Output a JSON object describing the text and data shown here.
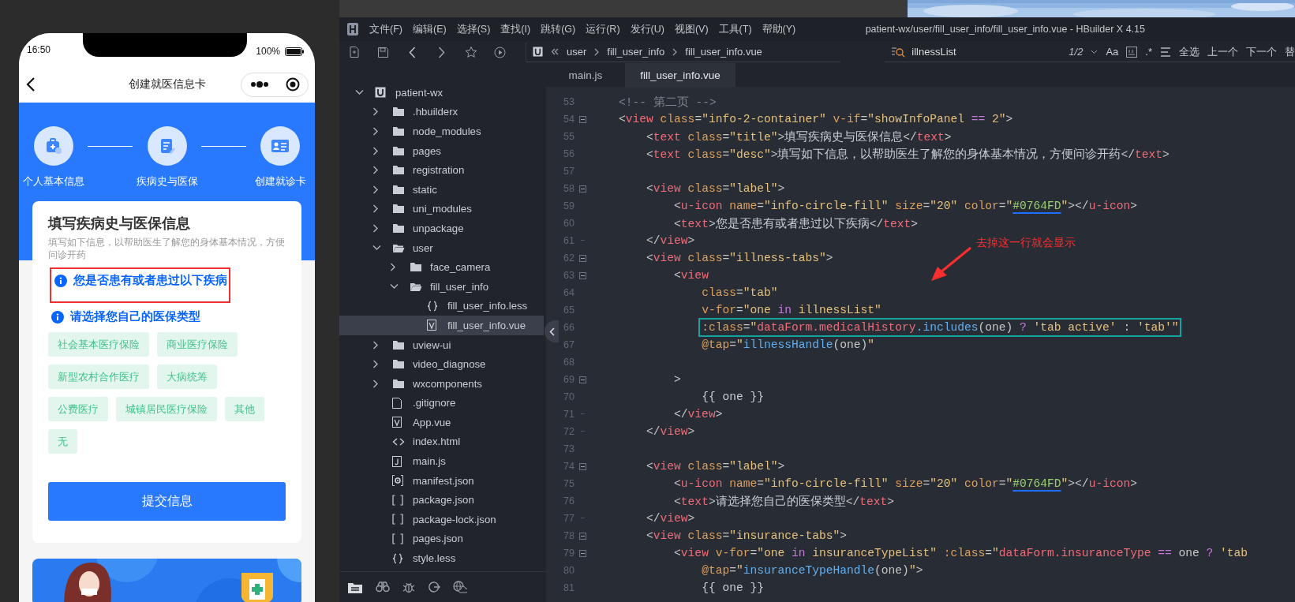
{
  "phone": {
    "time": "16:50",
    "battery": "100%",
    "title": "创建就医信息卡",
    "steps": [
      {
        "label": "个人基本信息",
        "kind": "kit"
      },
      {
        "label": "疾病史与医保",
        "kind": "doc"
      },
      {
        "label": "创建就诊卡",
        "kind": "card"
      }
    ],
    "form": {
      "title": "填写疾病史与医保信息",
      "desc": "填写如下信息，以帮助医生了解您的身体基本情况，方便问诊开药",
      "illness_label": "您是否患有或者患过以下疾病",
      "illness_highlighted": true,
      "insurance_label": "请选择您自己的医保类型",
      "insurance_types": [
        "社会基本医疗保险",
        "商业医疗保险",
        "新型农村合作医疗",
        "大病统筹",
        "公费医疗",
        "城镇居民医疗保险",
        "其他",
        "无"
      ],
      "submit": "提交信息"
    }
  },
  "ide": {
    "menu": [
      "文件(F)",
      "编辑(E)",
      "选择(S)",
      "查找(I)",
      "跳转(G)",
      "运行(R)",
      "发行(U)",
      "视图(V)",
      "工具(T)",
      "帮助(Y)"
    ],
    "window_title": "patient-wx/user/fill_user_info/fill_user_info.vue - HBuilder X 4.15",
    "breadcrumb": [
      "user",
      "fill_user_info",
      "fill_user_info.vue"
    ],
    "search": {
      "value": "illnessList",
      "count": "1/2",
      "case": "Aa",
      "regex": ".*",
      "select_all": "全选",
      "prev": "上一个",
      "next": "下一个",
      "replace": "替"
    },
    "tabs": [
      {
        "label": "main.js",
        "selected": false
      },
      {
        "label": "fill_user_info.vue",
        "selected": true
      }
    ],
    "tree": [
      {
        "name": "patient-wx",
        "kind": "project",
        "expanded": true,
        "selected": false,
        "children": [
          {
            "name": ".hbuilderx",
            "kind": "folder",
            "expanded": false,
            "selected": false
          },
          {
            "name": "node_modules",
            "kind": "folder",
            "expanded": false,
            "selected": false
          },
          {
            "name": "pages",
            "kind": "folder",
            "expanded": false,
            "selected": false
          },
          {
            "name": "registration",
            "kind": "folder",
            "expanded": false,
            "selected": false
          },
          {
            "name": "static",
            "kind": "folder",
            "expanded": false,
            "selected": false
          },
          {
            "name": "uni_modules",
            "kind": "folder",
            "expanded": false,
            "selected": false
          },
          {
            "name": "unpackage",
            "kind": "folder",
            "expanded": false,
            "selected": false
          },
          {
            "name": "user",
            "kind": "folder",
            "expanded": true,
            "selected": false,
            "children": [
              {
                "name": "face_camera",
                "kind": "folder",
                "expanded": false,
                "selected": false
              },
              {
                "name": "fill_user_info",
                "kind": "folder",
                "expanded": true,
                "selected": false,
                "children": [
                  {
                    "name": "fill_user_info.less",
                    "kind": "braces",
                    "selected": false
                  },
                  {
                    "name": "fill_user_info.vue",
                    "kind": "vue",
                    "selected": true
                  }
                ]
              }
            ]
          },
          {
            "name": "uview-ui",
            "kind": "folder",
            "expanded": false,
            "selected": false
          },
          {
            "name": "video_diagnose",
            "kind": "folder",
            "expanded": false,
            "selected": false
          },
          {
            "name": "wxcomponents",
            "kind": "folder",
            "expanded": false,
            "selected": false
          },
          {
            "name": ".gitignore",
            "kind": "doc",
            "selected": false
          },
          {
            "name": "App.vue",
            "kind": "vue",
            "selected": false
          },
          {
            "name": "index.html",
            "kind": "html",
            "selected": false
          },
          {
            "name": "main.js",
            "kind": "js",
            "selected": false
          },
          {
            "name": "manifest.json",
            "kind": "manifest",
            "selected": false
          },
          {
            "name": "package.json",
            "kind": "brackets",
            "selected": false
          },
          {
            "name": "package-lock.json",
            "kind": "brackets",
            "selected": false
          },
          {
            "name": "pages.json",
            "kind": "brackets",
            "selected": false
          },
          {
            "name": "style.less",
            "kind": "braces",
            "selected": false
          }
        ]
      }
    ],
    "lines": [
      {
        "n": "53",
        "tokens": [
          {
            "kind": "cmt",
            "text": "    <!-- 第二页 -->"
          }
        ]
      },
      {
        "n": "54",
        "foldable": true,
        "tokens": [
          {
            "kind": "p",
            "text": "    <"
          },
          {
            "kind": "tag",
            "text": "view"
          },
          {
            "kind": "attr",
            "text": " class"
          },
          {
            "kind": "p",
            "text": "="
          },
          {
            "kind": "str",
            "text": "\"info-2-container\""
          },
          {
            "kind": "attr",
            "text": " v-if"
          },
          {
            "kind": "p",
            "text": "="
          },
          {
            "kind": "str",
            "text": "\"showInfoPanel "
          },
          {
            "kind": "op",
            "text": "=="
          },
          {
            "kind": "str",
            "text": " 2\""
          },
          {
            "kind": "p",
            "text": ">"
          }
        ]
      },
      {
        "n": "55",
        "tokens": [
          {
            "kind": "p",
            "text": "        <"
          },
          {
            "kind": "tag",
            "text": "text"
          },
          {
            "kind": "attr",
            "text": " class"
          },
          {
            "kind": "p",
            "text": "="
          },
          {
            "kind": "str",
            "text": "\"title\""
          },
          {
            "kind": "p",
            "text": ">"
          },
          {
            "kind": "txt",
            "text": "填写疾病史与医保信息"
          },
          {
            "kind": "p",
            "text": "</"
          },
          {
            "kind": "tag",
            "text": "text"
          },
          {
            "kind": "p",
            "text": ">"
          }
        ]
      },
      {
        "n": "56",
        "tokens": [
          {
            "kind": "p",
            "text": "        <"
          },
          {
            "kind": "tag",
            "text": "text"
          },
          {
            "kind": "attr",
            "text": " class"
          },
          {
            "kind": "p",
            "text": "="
          },
          {
            "kind": "str",
            "text": "\"desc\""
          },
          {
            "kind": "p",
            "text": ">"
          },
          {
            "kind": "txt",
            "text": "填写如下信息，以帮助医生了解您的身体基本情况，方便问诊开药"
          },
          {
            "kind": "p",
            "text": "</"
          },
          {
            "kind": "tag",
            "text": "text"
          },
          {
            "kind": "p",
            "text": ">"
          }
        ]
      },
      {
        "n": "57"
      },
      {
        "n": "58",
        "foldable": true,
        "tokens": [
          {
            "kind": "p",
            "text": "        <"
          },
          {
            "kind": "tag",
            "text": "view"
          },
          {
            "kind": "attr",
            "text": " class"
          },
          {
            "kind": "p",
            "text": "="
          },
          {
            "kind": "str",
            "text": "\"label\""
          },
          {
            "kind": "p",
            "text": ">"
          }
        ]
      },
      {
        "n": "59",
        "tokens": [
          {
            "kind": "p",
            "text": "            <"
          },
          {
            "kind": "tag",
            "text": "u-icon"
          },
          {
            "kind": "attr",
            "text": " name"
          },
          {
            "kind": "p",
            "text": "="
          },
          {
            "kind": "str",
            "text": "\"info-circle-fill\""
          },
          {
            "kind": "attr",
            "text": " size"
          },
          {
            "kind": "p",
            "text": "="
          },
          {
            "kind": "str",
            "text": "\"20\""
          },
          {
            "kind": "attr",
            "text": " color"
          },
          {
            "kind": "p",
            "text": "="
          },
          {
            "kind": "str",
            "text": "\""
          },
          {
            "kind": "hex",
            "text": "#0764FD"
          },
          {
            "kind": "str",
            "text": "\""
          },
          {
            "kind": "p",
            "text": "></"
          },
          {
            "kind": "tag",
            "text": "u-icon"
          },
          {
            "kind": "p",
            "text": ">"
          }
        ]
      },
      {
        "n": "60",
        "tokens": [
          {
            "kind": "p",
            "text": "            <"
          },
          {
            "kind": "tag",
            "text": "text"
          },
          {
            "kind": "p",
            "text": ">"
          },
          {
            "kind": "txt",
            "text": "您是否患有或者患过以下疾病"
          },
          {
            "kind": "p",
            "text": "</"
          },
          {
            "kind": "tag",
            "text": "text"
          },
          {
            "kind": "p",
            "text": ">"
          }
        ]
      },
      {
        "n": "61",
        "fold_end": true,
        "tokens": [
          {
            "kind": "p",
            "text": "        </"
          },
          {
            "kind": "tag",
            "text": "view"
          },
          {
            "kind": "p",
            "text": ">"
          }
        ]
      },
      {
        "n": "62",
        "foldable": true,
        "tokens": [
          {
            "kind": "p",
            "text": "        <"
          },
          {
            "kind": "tag",
            "text": "view"
          },
          {
            "kind": "attr",
            "text": " class"
          },
          {
            "kind": "p",
            "text": "="
          },
          {
            "kind": "str",
            "text": "\"illness-tabs\""
          },
          {
            "kind": "p",
            "text": ">"
          }
        ]
      },
      {
        "n": "63",
        "foldable": true,
        "tokens": [
          {
            "kind": "p",
            "text": "            <"
          },
          {
            "kind": "tag",
            "text": "view"
          }
        ]
      },
      {
        "n": "64",
        "tokens": [
          {
            "kind": "attr",
            "text": "                class"
          },
          {
            "kind": "p",
            "text": "="
          },
          {
            "kind": "str",
            "text": "\"tab\""
          }
        ]
      },
      {
        "n": "65",
        "tokens": [
          {
            "kind": "attr",
            "text": "                v-for"
          },
          {
            "kind": "p",
            "text": "="
          },
          {
            "kind": "str",
            "text": "\"one "
          },
          {
            "kind": "op",
            "text": "in"
          },
          {
            "kind": "str",
            "text": " illnessList\""
          }
        ]
      },
      {
        "n": "66",
        "boxed": true,
        "tokens": [
          {
            "kind": "attr",
            "text": "                :class"
          },
          {
            "kind": "p",
            "text": "="
          },
          {
            "kind": "str",
            "text": "\""
          },
          {
            "kind": "var",
            "text": "dataForm.medicalHistory"
          },
          {
            "kind": "fn",
            "text": ".includes"
          },
          {
            "kind": "p",
            "text": "(one) "
          },
          {
            "kind": "op",
            "text": "?"
          },
          {
            "kind": "str",
            "text": " 'tab active'"
          },
          {
            "kind": "p",
            "text": " : "
          },
          {
            "kind": "str",
            "text": "'tab'\""
          }
        ]
      },
      {
        "n": "67",
        "tokens": [
          {
            "kind": "attr",
            "text": "                @tap"
          },
          {
            "kind": "p",
            "text": "="
          },
          {
            "kind": "str",
            "text": "\""
          },
          {
            "kind": "fn",
            "text": "illnessHandle"
          },
          {
            "kind": "p",
            "text": "(one)"
          },
          {
            "kind": "str",
            "text": "\""
          }
        ]
      },
      {
        "n": "68"
      },
      {
        "n": "69",
        "foldable": true,
        "tokens": [
          {
            "kind": "p",
            "text": "            >"
          }
        ]
      },
      {
        "n": "70",
        "tokens": [
          {
            "kind": "txt",
            "text": "                {{ one }}"
          }
        ]
      },
      {
        "n": "71",
        "fold_end": true,
        "tokens": [
          {
            "kind": "p",
            "text": "            </"
          },
          {
            "kind": "tag",
            "text": "view"
          },
          {
            "kind": "p",
            "text": ">"
          }
        ]
      },
      {
        "n": "72",
        "fold_end": true,
        "tokens": [
          {
            "kind": "p",
            "text": "        </"
          },
          {
            "kind": "tag",
            "text": "view"
          },
          {
            "kind": "p",
            "text": ">"
          }
        ]
      },
      {
        "n": "73"
      },
      {
        "n": "74",
        "foldable": true,
        "tokens": [
          {
            "kind": "p",
            "text": "        <"
          },
          {
            "kind": "tag",
            "text": "view"
          },
          {
            "kind": "attr",
            "text": " class"
          },
          {
            "kind": "p",
            "text": "="
          },
          {
            "kind": "str",
            "text": "\"label\""
          },
          {
            "kind": "p",
            "text": ">"
          }
        ]
      },
      {
        "n": "75",
        "tokens": [
          {
            "kind": "p",
            "text": "            <"
          },
          {
            "kind": "tag",
            "text": "u-icon"
          },
          {
            "kind": "attr",
            "text": " name"
          },
          {
            "kind": "p",
            "text": "="
          },
          {
            "kind": "str",
            "text": "\"info-circle-fill\""
          },
          {
            "kind": "attr",
            "text": " size"
          },
          {
            "kind": "p",
            "text": "="
          },
          {
            "kind": "str",
            "text": "\"20\""
          },
          {
            "kind": "attr",
            "text": " color"
          },
          {
            "kind": "p",
            "text": "="
          },
          {
            "kind": "str",
            "text": "\""
          },
          {
            "kind": "hex",
            "text": "#0764FD"
          },
          {
            "kind": "str",
            "text": "\""
          },
          {
            "kind": "p",
            "text": "></"
          },
          {
            "kind": "tag",
            "text": "u-icon"
          },
          {
            "kind": "p",
            "text": ">"
          }
        ]
      },
      {
        "n": "76",
        "tokens": [
          {
            "kind": "p",
            "text": "            <"
          },
          {
            "kind": "tag",
            "text": "text"
          },
          {
            "kind": "p",
            "text": ">"
          },
          {
            "kind": "txt",
            "text": "请选择您自己的医保类型"
          },
          {
            "kind": "p",
            "text": "</"
          },
          {
            "kind": "tag",
            "text": "text"
          },
          {
            "kind": "p",
            "text": ">"
          }
        ]
      },
      {
        "n": "77",
        "fold_end": true,
        "tokens": [
          {
            "kind": "p",
            "text": "        </"
          },
          {
            "kind": "tag",
            "text": "view"
          },
          {
            "kind": "p",
            "text": ">"
          }
        ]
      },
      {
        "n": "78",
        "foldable": true,
        "tokens": [
          {
            "kind": "p",
            "text": "        <"
          },
          {
            "kind": "tag",
            "text": "view"
          },
          {
            "kind": "attr",
            "text": " class"
          },
          {
            "kind": "p",
            "text": "="
          },
          {
            "kind": "str",
            "text": "\"insurance-tabs\""
          },
          {
            "kind": "p",
            "text": ">"
          }
        ]
      },
      {
        "n": "79",
        "foldable": true,
        "tokens": [
          {
            "kind": "p",
            "text": "            <"
          },
          {
            "kind": "tag",
            "text": "view"
          },
          {
            "kind": "attr",
            "text": " v-for"
          },
          {
            "kind": "p",
            "text": "="
          },
          {
            "kind": "str",
            "text": "\"one "
          },
          {
            "kind": "op",
            "text": "in"
          },
          {
            "kind": "str",
            "text": " insuranceTypeList\""
          },
          {
            "kind": "attr",
            "text": " :class"
          },
          {
            "kind": "p",
            "text": "="
          },
          {
            "kind": "str",
            "text": "\""
          },
          {
            "kind": "var",
            "text": "dataForm.insuranceType"
          },
          {
            "kind": "op",
            "text": " =="
          },
          {
            "kind": "p",
            "text": " one "
          },
          {
            "kind": "op",
            "text": "?"
          },
          {
            "kind": "str",
            "text": " 'tab"
          }
        ]
      },
      {
        "n": "80",
        "tokens": [
          {
            "kind": "attr",
            "text": "                @tap"
          },
          {
            "kind": "p",
            "text": "="
          },
          {
            "kind": "str",
            "text": "\""
          },
          {
            "kind": "fn",
            "text": "insuranceTypeHandle"
          },
          {
            "kind": "p",
            "text": "(one)"
          },
          {
            "kind": "str",
            "text": "\""
          },
          {
            "kind": "p",
            "text": ">"
          }
        ]
      },
      {
        "n": "81",
        "tokens": [
          {
            "kind": "txt",
            "text": "                {{ one }}"
          }
        ]
      }
    ],
    "annotation": "去掉这一行就会显示"
  }
}
